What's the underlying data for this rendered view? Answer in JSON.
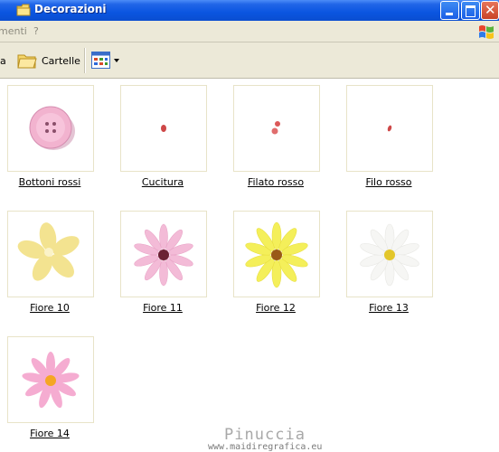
{
  "window": {
    "title": "Decorazioni"
  },
  "menu": {
    "items": [
      "menti",
      "?"
    ]
  },
  "toolbar": {
    "left_fragment": "a",
    "folders_label": "Cartelle"
  },
  "items": [
    {
      "label": "Bottoni rossi",
      "icon": "button-icon"
    },
    {
      "label": "Cucitura",
      "icon": "stitch-dot-icon"
    },
    {
      "label": "Filato rosso",
      "icon": "red-yarn-icon"
    },
    {
      "label": "Filo rosso",
      "icon": "red-thread-icon"
    },
    {
      "label": "Fiore 10",
      "icon": "yellow-flower-icon"
    },
    {
      "label": "Fiore 11",
      "icon": "pink-daisy-icon"
    },
    {
      "label": "Fiore 12",
      "icon": "yellow-daisy-icon"
    },
    {
      "label": "Fiore 13",
      "icon": "white-daisy-icon"
    },
    {
      "label": "Fiore 14",
      "icon": "pink-flower-icon"
    }
  ],
  "watermark": {
    "name": "Pinuccia",
    "url": "www.maidiregrafica.eu"
  },
  "colors": {
    "titlebar": "#0a55e0",
    "chrome": "#ece9d8",
    "close_button": "#c84227"
  }
}
